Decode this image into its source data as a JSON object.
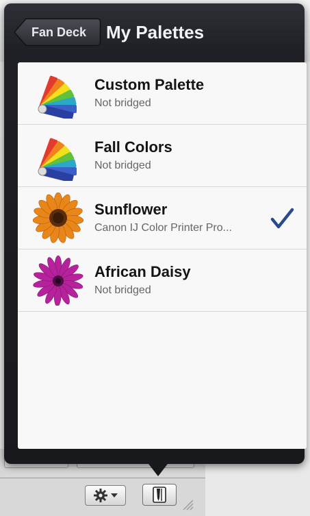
{
  "header": {
    "back_label": "Fan Deck",
    "title": "My Palettes"
  },
  "palettes": [
    {
      "name": "Custom Palette",
      "status": "Not bridged",
      "icon": "fan-deck-icon",
      "selected": false
    },
    {
      "name": "Fall Colors",
      "status": "Not bridged",
      "icon": "fan-deck-icon",
      "selected": false
    },
    {
      "name": "Sunflower",
      "status": "Canon IJ Color Printer Pro...",
      "icon": "sunflower-thumbnail",
      "selected": true
    },
    {
      "name": "African Daisy",
      "status": "Not bridged",
      "icon": "african-daisy-thumbnail",
      "selected": false
    }
  ],
  "toolbar": {
    "gear_icon": "gear-icon",
    "menu_arrow": "chevron-down-icon",
    "palette_icon": "palette-icon"
  },
  "colors": {
    "popover": "#1e2025",
    "checkmark": "#2b4a8a",
    "list_bg": "#f8f8f8"
  }
}
